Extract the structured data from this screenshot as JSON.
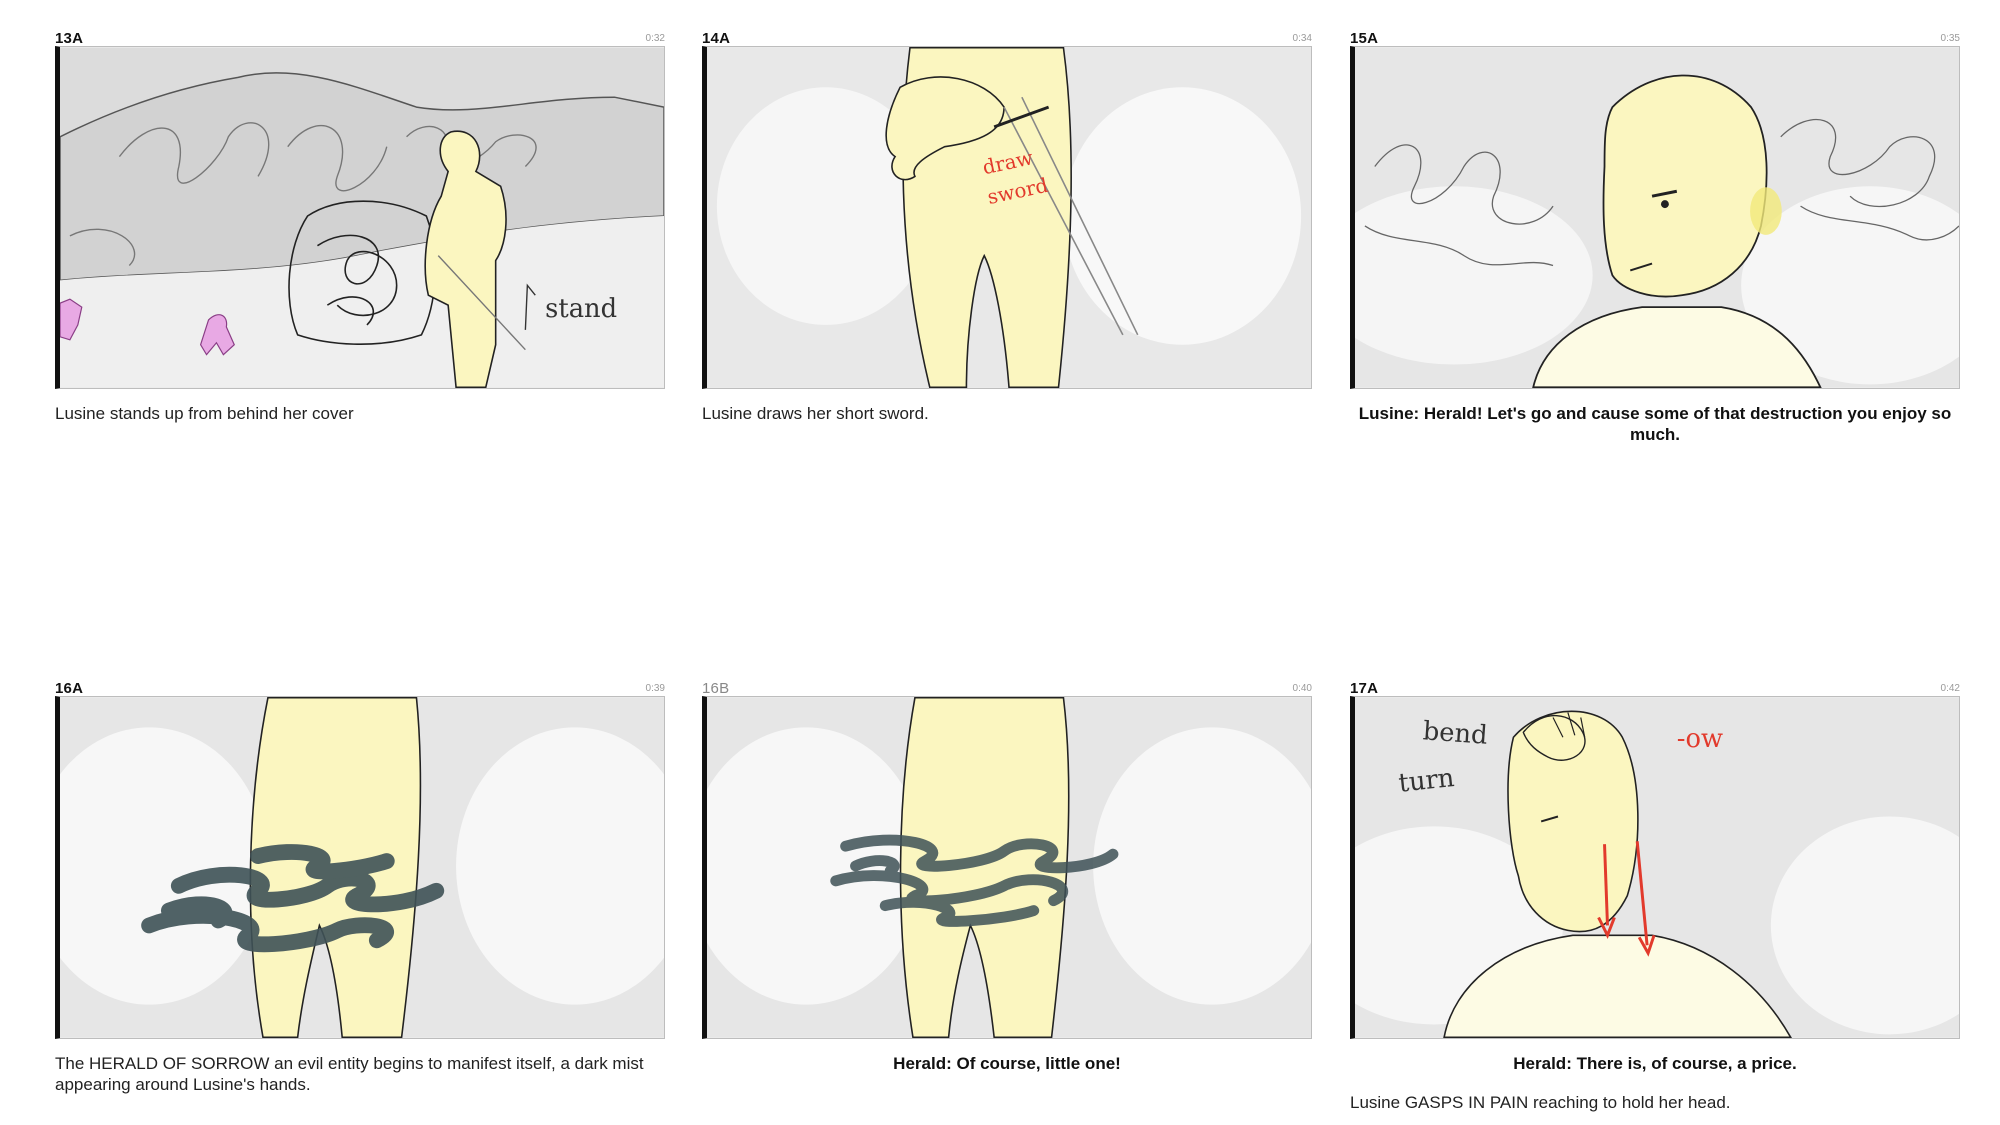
{
  "panels": [
    {
      "shot": "13A",
      "time": "0:32",
      "captions": [
        {
          "text": "Lusine stands up from behind her cover"
        }
      ],
      "annotations": [
        "stand"
      ]
    },
    {
      "shot": "14A",
      "time": "0:34",
      "captions": [
        {
          "text": "Lusine draws her short sword."
        }
      ],
      "annotations": [
        "draw",
        "sword"
      ]
    },
    {
      "shot": "15A",
      "time": "0:35",
      "captions": [
        {
          "text": "Lusine: Herald! Let's go and cause some of that destruction you enjoy so much."
        }
      ]
    },
    {
      "shot": "16A",
      "time": "0:39",
      "captions": [
        {
          "text": "The HERALD OF SORROW an evil entity begins to manifest itself, a dark mist appearing around Lusine's hands."
        }
      ]
    },
    {
      "shot": "16B",
      "time": "0:40",
      "captions": [
        {
          "text": "Herald: Of course, little one!"
        }
      ]
    },
    {
      "shot": "17A",
      "time": "0:42",
      "captions": [
        {
          "text": "Herald: There is, of course, a price."
        },
        {
          "text": "Lusine GASPS IN PAIN reaching to hold her head."
        }
      ],
      "annotations": [
        "bend",
        "turn",
        "-ow"
      ]
    }
  ],
  "colors": {
    "skin": "#fbf6c0",
    "mist": "#3f5257",
    "red_note": "#e23a2c",
    "pink_figure": "#d98ad6",
    "frame_bg": "#ececec"
  }
}
